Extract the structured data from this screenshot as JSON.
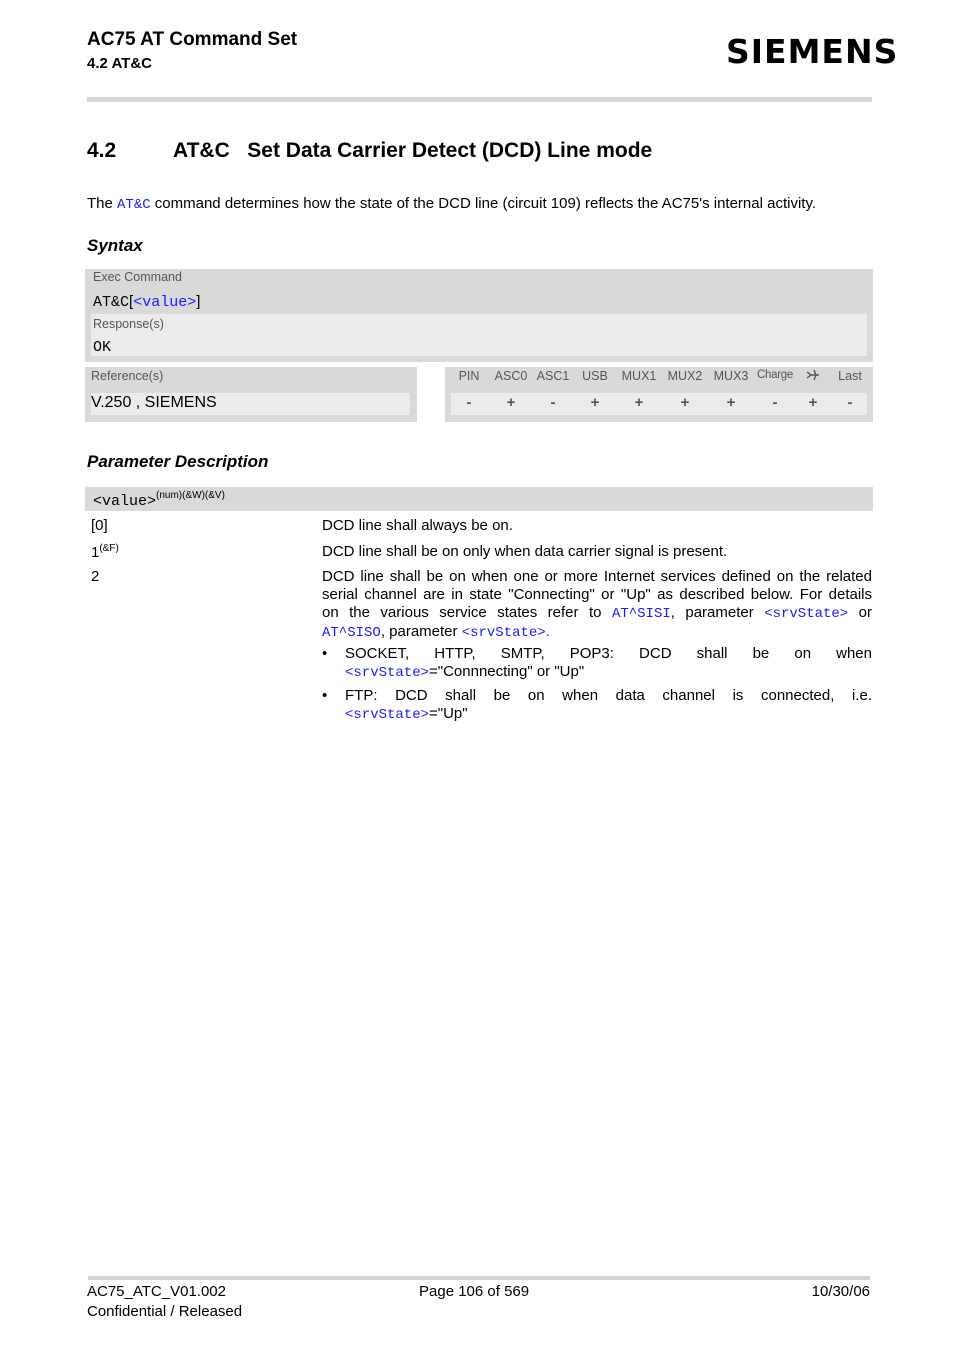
{
  "header": {
    "title": "AC75 AT Command Set",
    "subtitle": "4.2 AT&C",
    "logo": "SIEMENS"
  },
  "section": {
    "number": "4.2",
    "title": "AT&C   Set Data Carrier Detect (DCD) Line mode"
  },
  "intro": {
    "prefix": "The ",
    "command_link": "AT&C",
    "suffix": " command determines how the state of the DCD line (circuit 109) reflects the AC75's internal activity."
  },
  "syntax": {
    "heading": "Syntax",
    "exec_label": "Exec Command",
    "exec_cmd": "AT&C",
    "exec_open": "[",
    "exec_param": "<value>",
    "exec_close": "]",
    "response_label": "Response(s)",
    "response_value": "OK",
    "reference_label": "Reference(s)",
    "reference_value": "V.250 , SIEMENS",
    "interfaces": [
      {
        "name": "PIN",
        "value": "-"
      },
      {
        "name": "ASC0",
        "value": "+"
      },
      {
        "name": "ASC1",
        "value": "-"
      },
      {
        "name": "USB",
        "value": "+"
      },
      {
        "name": "MUX1",
        "value": "+"
      },
      {
        "name": "MUX2",
        "value": "+"
      },
      {
        "name": "MUX3",
        "value": "+"
      },
      {
        "name": "Charge",
        "value": "-"
      },
      {
        "name": "airplane-icon",
        "value": "+"
      },
      {
        "name": "Last",
        "value": "-"
      }
    ]
  },
  "parameters": {
    "heading": "Parameter Description",
    "name": "<value>",
    "name_sup": "(num)(&W)(&V)",
    "values": [
      {
        "value": "[0]",
        "sup": "",
        "desc": "DCD line shall always be on."
      },
      {
        "value": "1",
        "sup": "(&F)",
        "desc": "DCD line shall be on only when data carrier signal is present."
      },
      {
        "value": "2",
        "sup": ""
      }
    ],
    "value2": {
      "line1": "DCD line shall be on when one or more Internet services defined on the related",
      "line2": "serial channel are in state \"Connecting\" or \"Up\" as described below. For details",
      "line3_a": "on the various service states refer to ",
      "line3_link1": "AT^SISI",
      "line3_b": ", parameter ",
      "line3_link2": "<srvState>",
      "line3_c": " or",
      "line4_link1": "AT^SISO",
      "line4_b": ", parameter ",
      "line4_link2": "<srvState>",
      "line4_c": ".",
      "bullets": [
        {
          "line1": "SOCKET,  HTTP,  SMTP,  POP3:  DCD  shall  be  on  when",
          "link": "<srvState>",
          "rest": "=\"Connnecting\" or \"Up\""
        },
        {
          "line1": "FTP:  DCD  shall  be  on  when  data  channel  is  connected,  i.e.",
          "link": "<srvState>",
          "rest": "=\"Up\""
        }
      ],
      "bullet_char": "•"
    }
  },
  "footer": {
    "doc_id": "AC75_ATC_V01.002",
    "status": "Confidential / Released",
    "page": "Page 106 of 569",
    "date": "10/30/06"
  }
}
